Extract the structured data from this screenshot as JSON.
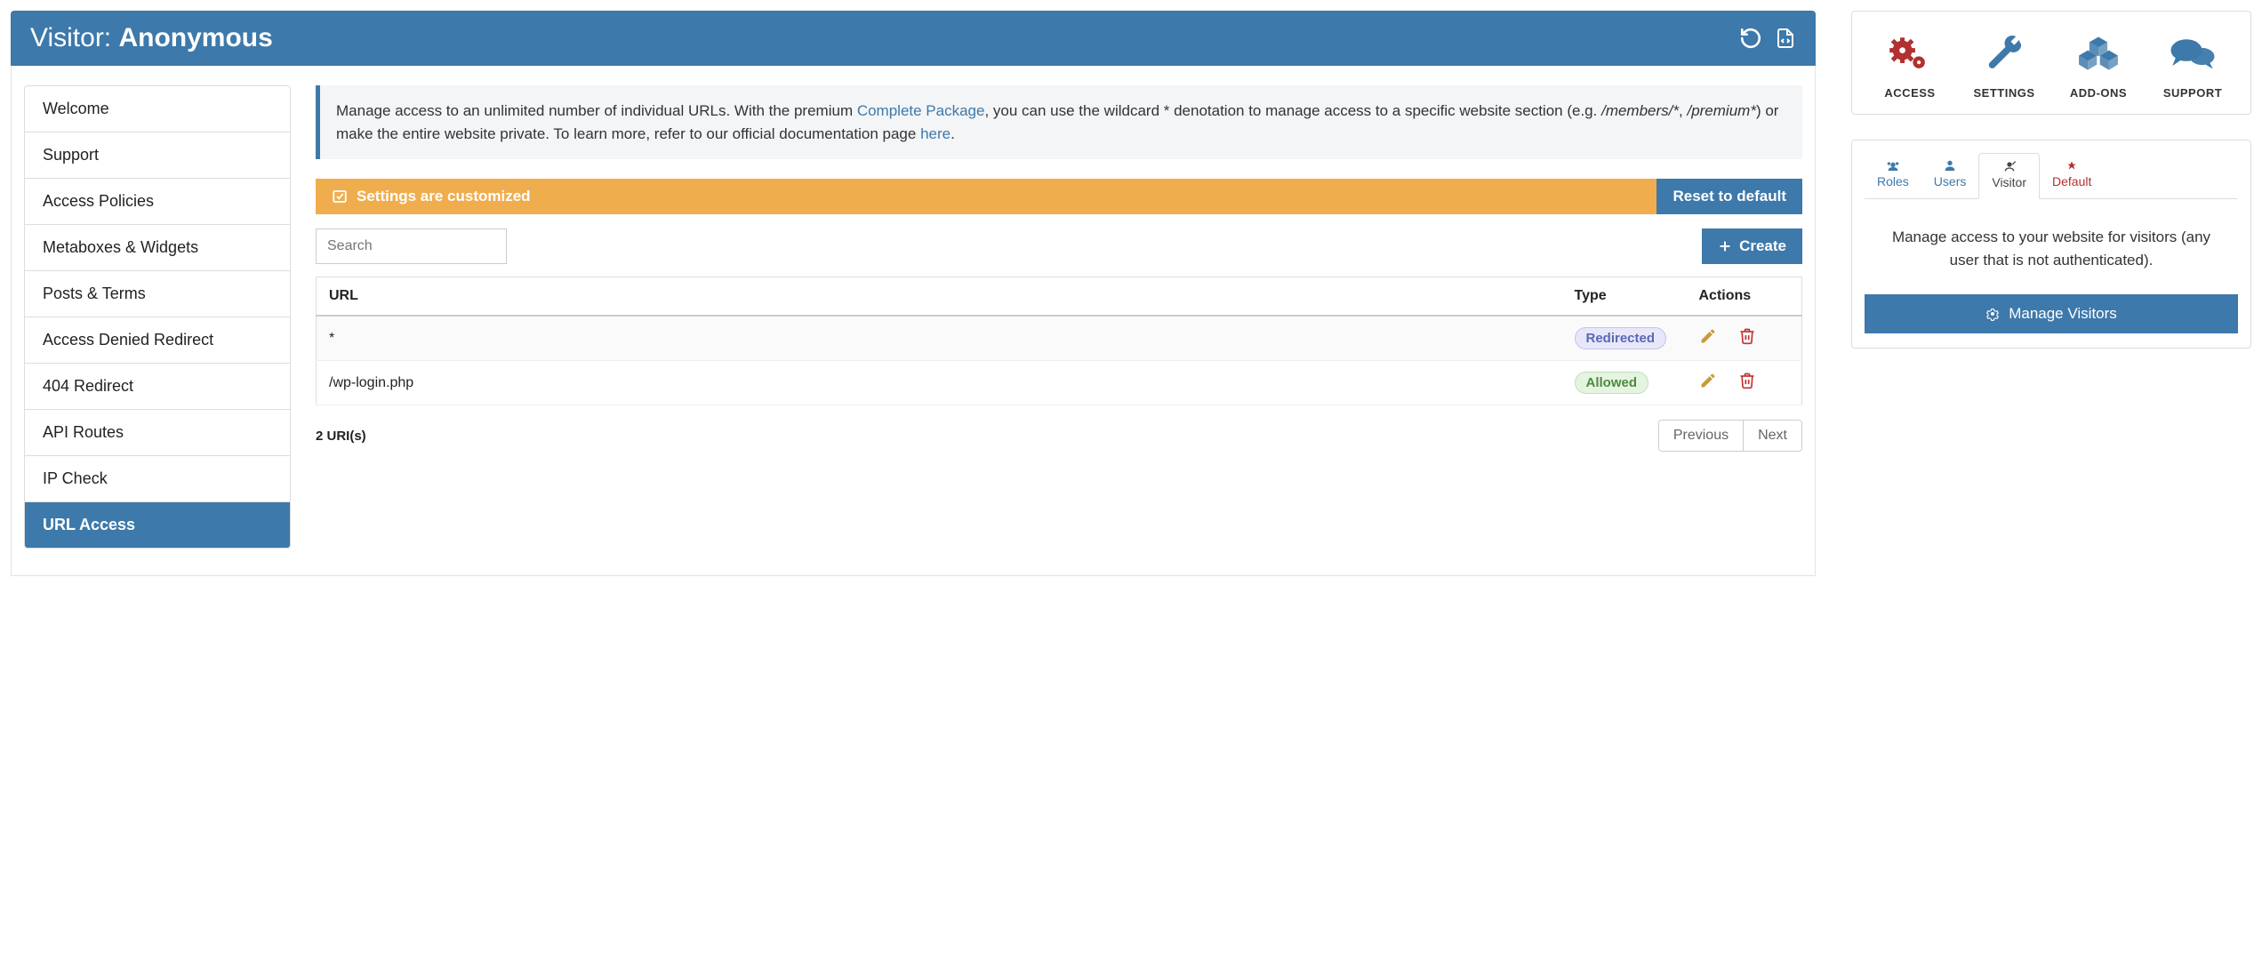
{
  "header": {
    "title_prefix": "Visitor: ",
    "title_strong": "Anonymous"
  },
  "sidebar": {
    "items": [
      {
        "label": "Welcome"
      },
      {
        "label": "Support"
      },
      {
        "label": "Access Policies"
      },
      {
        "label": "Metaboxes & Widgets"
      },
      {
        "label": "Posts & Terms"
      },
      {
        "label": "Access Denied Redirect"
      },
      {
        "label": "404 Redirect"
      },
      {
        "label": "API Routes"
      },
      {
        "label": "IP Check"
      },
      {
        "label": "URL Access"
      }
    ],
    "active_index": 9
  },
  "info": {
    "text1": "Manage access to an unlimited number of individual URLs. With the premium ",
    "link1": "Complete Package",
    "text2": ", you can use the wildcard * denotation to manage access to a specific website section (e.g. ",
    "italic1": "/members/*",
    "text3": ", ",
    "italic2": "/premium*",
    "text4": ") or make the entire website private. To learn more, refer to our official documentation page ",
    "link2": "here",
    "text5": "."
  },
  "status_bar": {
    "message": "Settings are customized",
    "reset_label": "Reset to default"
  },
  "toolbar": {
    "search_placeholder": "Search",
    "create_label": "Create"
  },
  "table": {
    "headers": {
      "url": "URL",
      "type": "Type",
      "actions": "Actions"
    },
    "rows": [
      {
        "url": "*",
        "type": "Redirected",
        "type_class": "redirected"
      },
      {
        "url": "/wp-login.php",
        "type": "Allowed",
        "type_class": "allowed"
      }
    ],
    "count_label": "2 URI(s)",
    "pager": {
      "prev": "Previous",
      "next": "Next"
    }
  },
  "right": {
    "top": [
      {
        "key": "access",
        "label": "ACCESS"
      },
      {
        "key": "settings",
        "label": "SETTINGS"
      },
      {
        "key": "addons",
        "label": "ADD-ONS"
      },
      {
        "key": "support",
        "label": "SUPPORT"
      }
    ],
    "tabs": [
      {
        "key": "roles",
        "label": "Roles"
      },
      {
        "key": "users",
        "label": "Users"
      },
      {
        "key": "visitor",
        "label": "Visitor"
      },
      {
        "key": "default",
        "label": "Default"
      }
    ],
    "visitor_desc": "Manage access to your website for visitors (any user that is not authenticated).",
    "manage_label": "Manage Visitors"
  }
}
